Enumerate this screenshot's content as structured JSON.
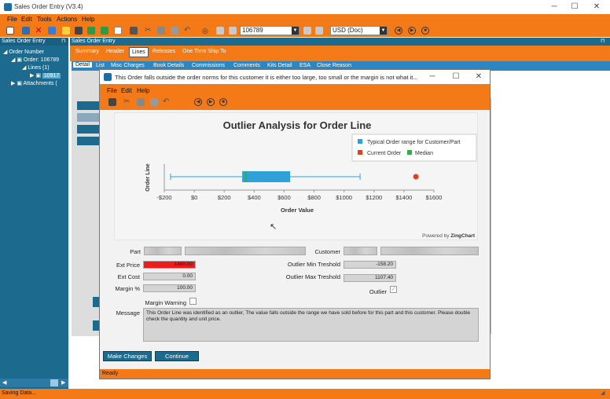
{
  "window": {
    "title": "Sales Order Entry (V3.4)",
    "menu": [
      "File",
      "Edit",
      "Tools",
      "Actions",
      "Help"
    ],
    "toolbar": {
      "order_number": "106789",
      "currency": "USD (Doc)"
    }
  },
  "left_panel": {
    "header": "Sales Order Entry",
    "pin": "⊓",
    "tree": {
      "root": "Order Number",
      "order": "Order: 106789",
      "lines": "Lines (1)",
      "line": "10917",
      "attachments": "Attachments ("
    }
  },
  "right_panel": {
    "header": "Sales Order Entry",
    "tabs": [
      "Summary",
      "Header",
      "Lines",
      "Releases",
      "One Time Ship To"
    ],
    "active_tab": "Lines",
    "subtabs": [
      "Detail",
      "List",
      "Misc Charges",
      "Book Details",
      "Commissions",
      "Comments",
      "Kits Detail",
      "ESA",
      "Close Reason"
    ]
  },
  "dialog": {
    "title": "This Order falls outside the order norms for this customer it is either too large, too small or the margin is not what it...",
    "menu": [
      "File",
      "Edit",
      "Help"
    ],
    "fields": {
      "part_label": "Part",
      "customer_label": "Customer",
      "ext_price_label": "Ext Price",
      "ext_price": "1480.00",
      "ext_cost_label": "Ext Cost",
      "ext_cost": "0.00",
      "margin_label": "Margin %",
      "margin": "100.00",
      "min_label": "Outlier Min Treshold",
      "min_value": "-158.20",
      "max_label": "Outlier Max Treshold",
      "max_value": "1107.40",
      "outlier_label": "Outlier",
      "warning_label": "Margin Warning",
      "message_label": "Message",
      "message": "This Order Line was identified as an outlier, The value falls outside the range we have sold before for this part and this customer. Please double check the quantity and unit price."
    },
    "buttons": {
      "make_changes": "Make Changes",
      "continue": "Continue"
    },
    "status": "Ready",
    "powered_prefix": "Powered by ",
    "powered_brand": "ZingChart"
  },
  "chart_data": {
    "type": "boxplot",
    "title": "Outlier Analysis for Order Line",
    "xlabel": "Order Value",
    "ylabel": "Order Line",
    "xlim": [
      -200,
      1600
    ],
    "ticks": [
      -200,
      0,
      200,
      400,
      600,
      800,
      1000,
      1200,
      1400,
      1600
    ],
    "tick_labels": [
      "-$200",
      "$0",
      "$200",
      "$400",
      "$600",
      "$800",
      "$1000",
      "$1200",
      "$1400",
      "$1600"
    ],
    "box": {
      "min": -158,
      "q1": 320,
      "median": 345,
      "q3": 640,
      "max": 1107
    },
    "outlier": 1480,
    "legend": [
      "Typical Order range for Customer/Part",
      "Current Order",
      "Median"
    ],
    "colors": {
      "box": "#2ea1d8",
      "outlier": "#e0401c",
      "median": "#2bb04a"
    }
  },
  "status_bar": "Saving Data..."
}
